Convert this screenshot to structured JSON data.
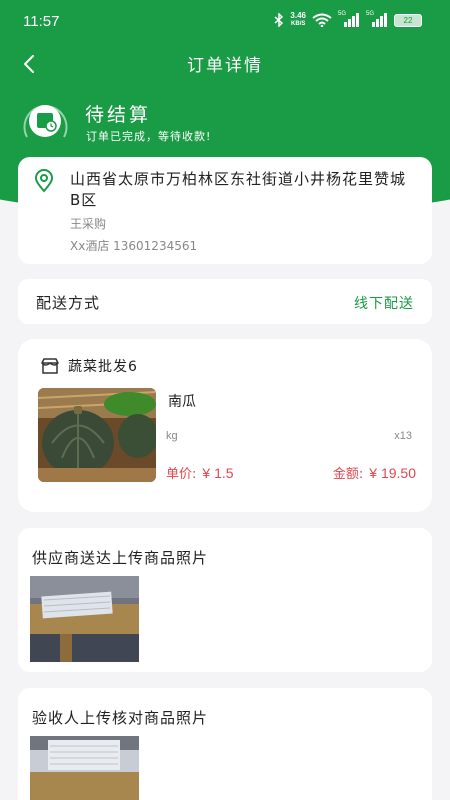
{
  "status_bar": {
    "time": "11:57",
    "net_speed_value": "3.46",
    "net_speed_unit": "KB/S",
    "signal1_label": "5G",
    "signal2_label": "5G",
    "battery": "22"
  },
  "nav": {
    "title": "订单详情",
    "back_icon": "chevron-left-icon"
  },
  "order_status": {
    "title": "待结算",
    "subtitle": "订单已完成，等待收款!",
    "icon": "clock-icon"
  },
  "address": {
    "text": "山西省太原市万柏林区东社街道小井杨花里赞城B区",
    "recipient": "王采购",
    "phone_line": "Xx酒店  13601234561",
    "icon": "location-pin-icon"
  },
  "delivery": {
    "label": "配送方式",
    "value": "线下配送"
  },
  "store": {
    "name": "蔬菜批发6",
    "icon": "store-icon"
  },
  "product": {
    "name": "南瓜",
    "unit": "kg",
    "quantity": "x13",
    "unit_price_label": "单价:",
    "unit_price": "¥ 1.5",
    "amount_label": "金额:",
    "amount": "¥ 19.50"
  },
  "photos": {
    "supplier_title": "供应商送达上传商品照片",
    "receiver_title": "验收人上传核对商品照片"
  },
  "colors": {
    "brand_green": "#1a9b46",
    "price_red": "#e0474c",
    "background": "#f4f4f6"
  }
}
